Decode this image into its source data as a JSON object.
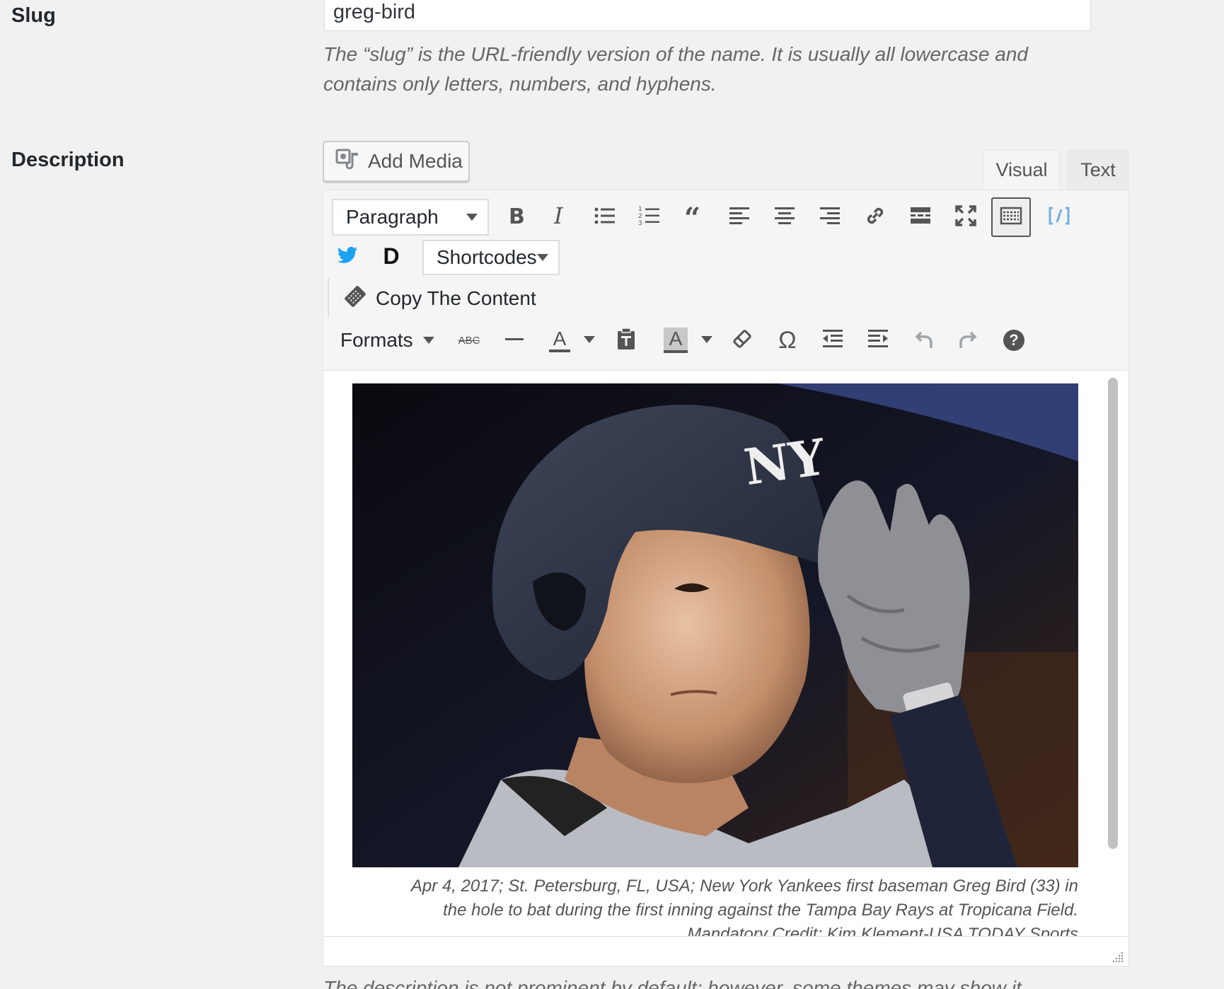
{
  "slug": {
    "label": "Slug",
    "value": "greg-bird",
    "help_line1": "The “slug” is the URL-friendly version of the name. It is usually all lowercase and",
    "help_line2": "contains only letters, numbers, and hyphens."
  },
  "description": {
    "label": "Description",
    "add_media_label": "Add Media",
    "tabs": [
      {
        "label": "Visual",
        "active": true
      },
      {
        "label": "Text",
        "active": false
      }
    ],
    "toolbar": {
      "format_select": "Paragraph",
      "shortcodes_select": "Shortcodes",
      "d_button_label": "D",
      "copy_content_label": "Copy The Content",
      "formats_menu": "Formats",
      "strikethrough_label": "ABC",
      "text_color_letter": "A",
      "bg_color_letter": "A",
      "omega_label": "Ω",
      "help_label": "?"
    },
    "content": {
      "caption_line1": "Apr 4, 2017; St. Petersburg, FL, USA; New York Yankees first baseman Greg Bird (33) in",
      "caption_line2": "the hole to bat during the first inning against the Tampa Bay Rays at Tropicana Field.",
      "caption_line3": "Mandatory Credit: Kim Klement-USA TODAY Sports"
    },
    "footer_help": "The description is not prominent by default; however, some themes may show it."
  },
  "colors": {
    "page_bg": "#f1f1f1",
    "twitter_blue": "#1da1f2",
    "code_icon_blue": "#72aee6"
  },
  "icons": [
    "add-media-icon",
    "bold-icon",
    "italic-icon",
    "bulleted-list-icon",
    "numbered-list-icon",
    "blockquote-icon",
    "align-left-icon",
    "align-center-icon",
    "align-right-icon",
    "link-icon",
    "read-more-icon",
    "fullscreen-icon",
    "toolbar-toggle-icon",
    "code-icon",
    "twitter-icon",
    "copy-icon",
    "strikethrough-icon",
    "horizontal-line-icon",
    "text-color-icon",
    "paste-text-icon",
    "background-color-icon",
    "clear-formatting-icon",
    "special-character-icon",
    "outdent-icon",
    "indent-icon",
    "undo-icon",
    "redo-icon",
    "help-icon"
  ]
}
